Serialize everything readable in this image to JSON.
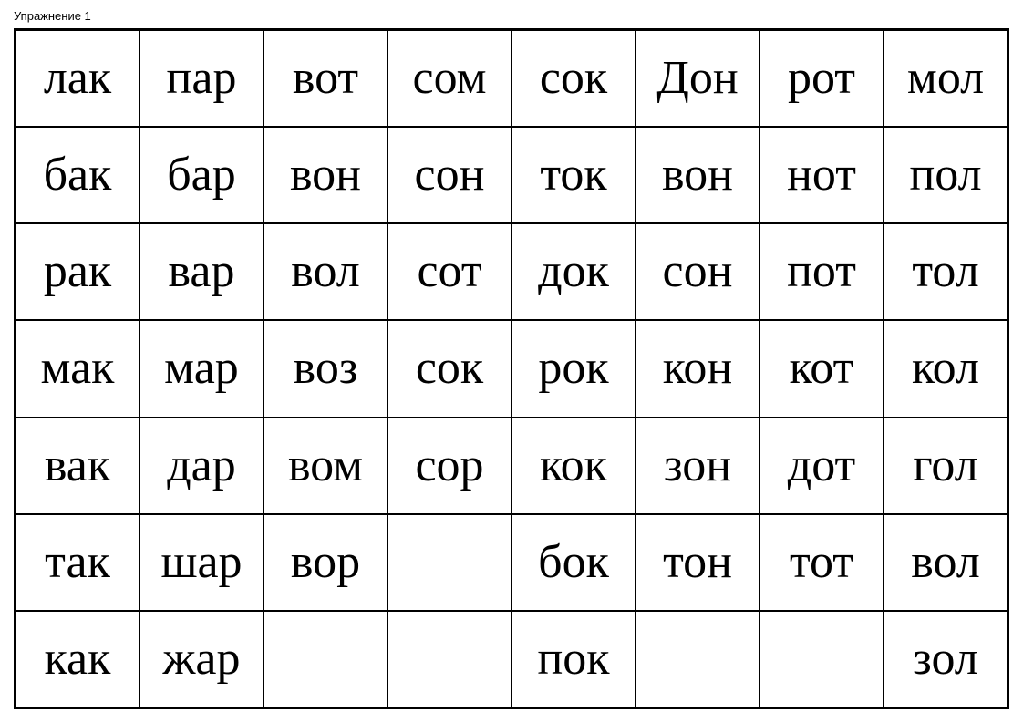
{
  "exercise": {
    "label": "Упражнение 1"
  },
  "grid": {
    "rows": [
      [
        "лак",
        "пар",
        "вот",
        "сом",
        "сок",
        "Дон",
        "рот",
        "мол"
      ],
      [
        "бак",
        "бар",
        "вон",
        "сон",
        "ток",
        "вон",
        "нот",
        "пол"
      ],
      [
        "рак",
        "вар",
        "вол",
        "сот",
        "док",
        "сон",
        "пот",
        "тол"
      ],
      [
        "мак",
        "мар",
        "воз",
        "сок",
        "рок",
        "кон",
        "кот",
        "кол"
      ],
      [
        "вак",
        "дар",
        "вом",
        "сор",
        "кок",
        "зон",
        "дот",
        "гол"
      ],
      [
        "так",
        "шар",
        "вор",
        "",
        "бок",
        "тон",
        "тот",
        "вол"
      ],
      [
        "как",
        "жар",
        "",
        "",
        "пок",
        "",
        "",
        "зол"
      ]
    ]
  }
}
